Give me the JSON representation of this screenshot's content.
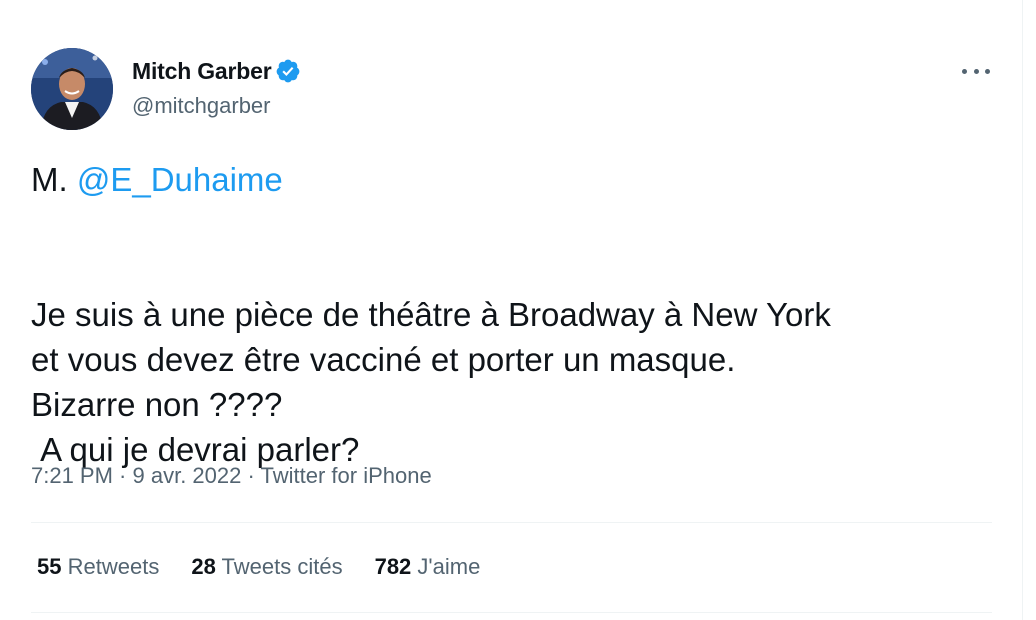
{
  "author": {
    "display_name": "Mitch Garber",
    "handle": "@mitchgarber",
    "verified": true,
    "verified_color": "#1d9bf0"
  },
  "tweet": {
    "prefix": "M. ",
    "mention": "@E_Duhaime",
    "body": "Je suis à une pièce de théâtre à Broadway à New York\net vous devez être vacciné et porter un masque.\nBizarre non ????\n A qui je devrai parler?"
  },
  "meta": {
    "time": "7:21 PM",
    "separator": " · ",
    "date": "9 avr. 2022",
    "source": "Twitter for iPhone"
  },
  "stats": [
    {
      "count": "55",
      "label": "Retweets"
    },
    {
      "count": "28",
      "label": "Tweets cités"
    },
    {
      "count": "782",
      "label": "J'aime"
    }
  ],
  "icons": {
    "more": "more-horizontal-icon",
    "verified": "verified-badge-icon"
  },
  "colors": {
    "text": "#0f1419",
    "secondary": "#536471",
    "link": "#1d9bf0",
    "divider": "#eff3f4"
  }
}
